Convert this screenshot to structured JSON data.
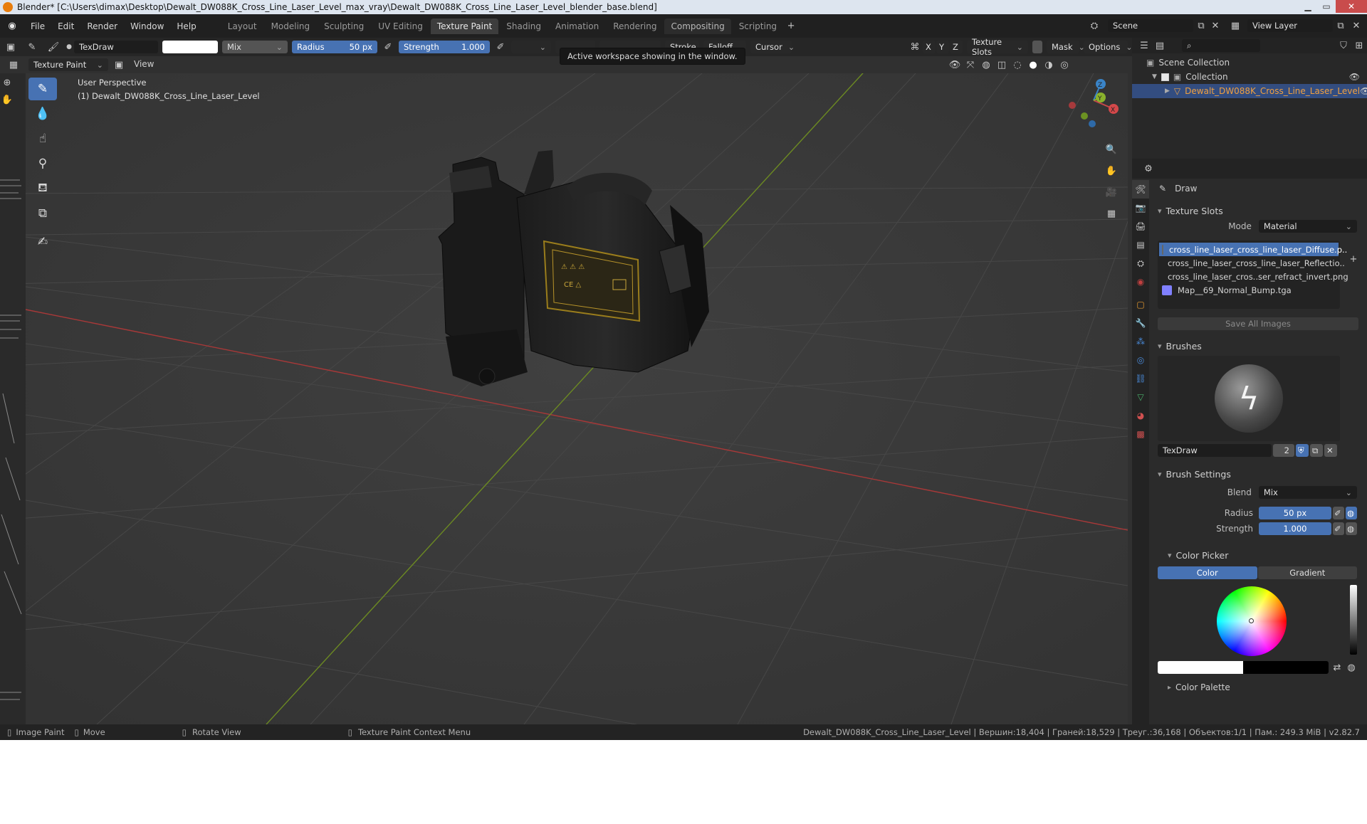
{
  "window": {
    "title": "Blender* [C:\\Users\\dimax\\Desktop\\Dewalt_DW088K_Cross_Line_Laser_Level_max_vray\\Dewalt_DW088K_Cross_Line_Laser_Level_blender_base.blend]"
  },
  "menu": [
    "File",
    "Edit",
    "Render",
    "Window",
    "Help"
  ],
  "workspaces": [
    "Layout",
    "Modeling",
    "Sculpting",
    "UV Editing",
    "Texture Paint",
    "Shading",
    "Animation",
    "Rendering",
    "Compositing",
    "Scripting"
  ],
  "active_workspace": "Texture Paint",
  "scene": {
    "name": "Scene",
    "view_layer": "View Layer"
  },
  "tool_header": {
    "brush_name": "TexDraw",
    "blend": "Mix",
    "radius_label": "Radius",
    "radius_value": "50 px",
    "strength_label": "Strength",
    "strength_value": "1.000",
    "stroke": "Stroke",
    "falloff": "Falloff",
    "cursor": "Cursor",
    "axes": [
      "X",
      "Y",
      "Z"
    ],
    "texture_slots": "Texture Slots",
    "mask": "Mask",
    "options": "Options"
  },
  "tooltip": "Active workspace showing in the window.",
  "view_header": {
    "mode": "Texture Paint",
    "view": "View"
  },
  "viewport": {
    "perspective": "User Perspective",
    "object": "(1) Dewalt_DW088K_Cross_Line_Laser_Level"
  },
  "gizmo": {
    "x": "X",
    "y": "Y",
    "z": "Z"
  },
  "outliner": {
    "root": "Scene Collection",
    "collection": "Collection",
    "object": "Dewalt_DW088K_Cross_Line_Laser_Level"
  },
  "properties": {
    "tool_name": "Draw",
    "texture_slots_header": "Texture Slots",
    "mode_label": "Mode",
    "mode_value": "Material",
    "slots": [
      {
        "name": "cross_line_laser_cross_line_laser_Diffuse.p..",
        "color": "#2a2a2a"
      },
      {
        "name": "cross_line_laser_cross_line_laser_Reflectio..",
        "color": "#f0f0f0"
      },
      {
        "name": "cross_line_laser_cros..ser_refract_invert.png",
        "color": "#ffffff"
      },
      {
        "name": "Map__69_Normal_Bump.tga",
        "color": "#8080ff"
      }
    ],
    "save_all": "Save All Images",
    "brushes_header": "Brushes",
    "brush_name": "TexDraw",
    "brush_users": "2",
    "brush_settings_header": "Brush Settings",
    "blend_label": "Blend",
    "blend_value": "Mix",
    "radius_label": "Radius",
    "radius_value": "50 px",
    "strength_label": "Strength",
    "strength_value": "1.000",
    "color_picker_header": "Color Picker",
    "color_tab": "Color",
    "gradient_tab": "Gradient",
    "color_palette_header": "Color Palette"
  },
  "status": {
    "image_paint": "Image Paint",
    "move": "Move",
    "rotate": "Rotate View",
    "context_menu": "Texture Paint Context Menu",
    "stats": "Dewalt_DW088K_Cross_Line_Laser_Level | Вершин:18,404 | Граней:18,529 | Треуг.:36,168 | Объектов:1/1 | Пам.: 249.3 MiB | v2.82.7"
  },
  "colors": {
    "accent": "#4772b3",
    "orange": "#e87d0d",
    "axis_red": "#a83838",
    "axis_green": "#6c8a22"
  }
}
